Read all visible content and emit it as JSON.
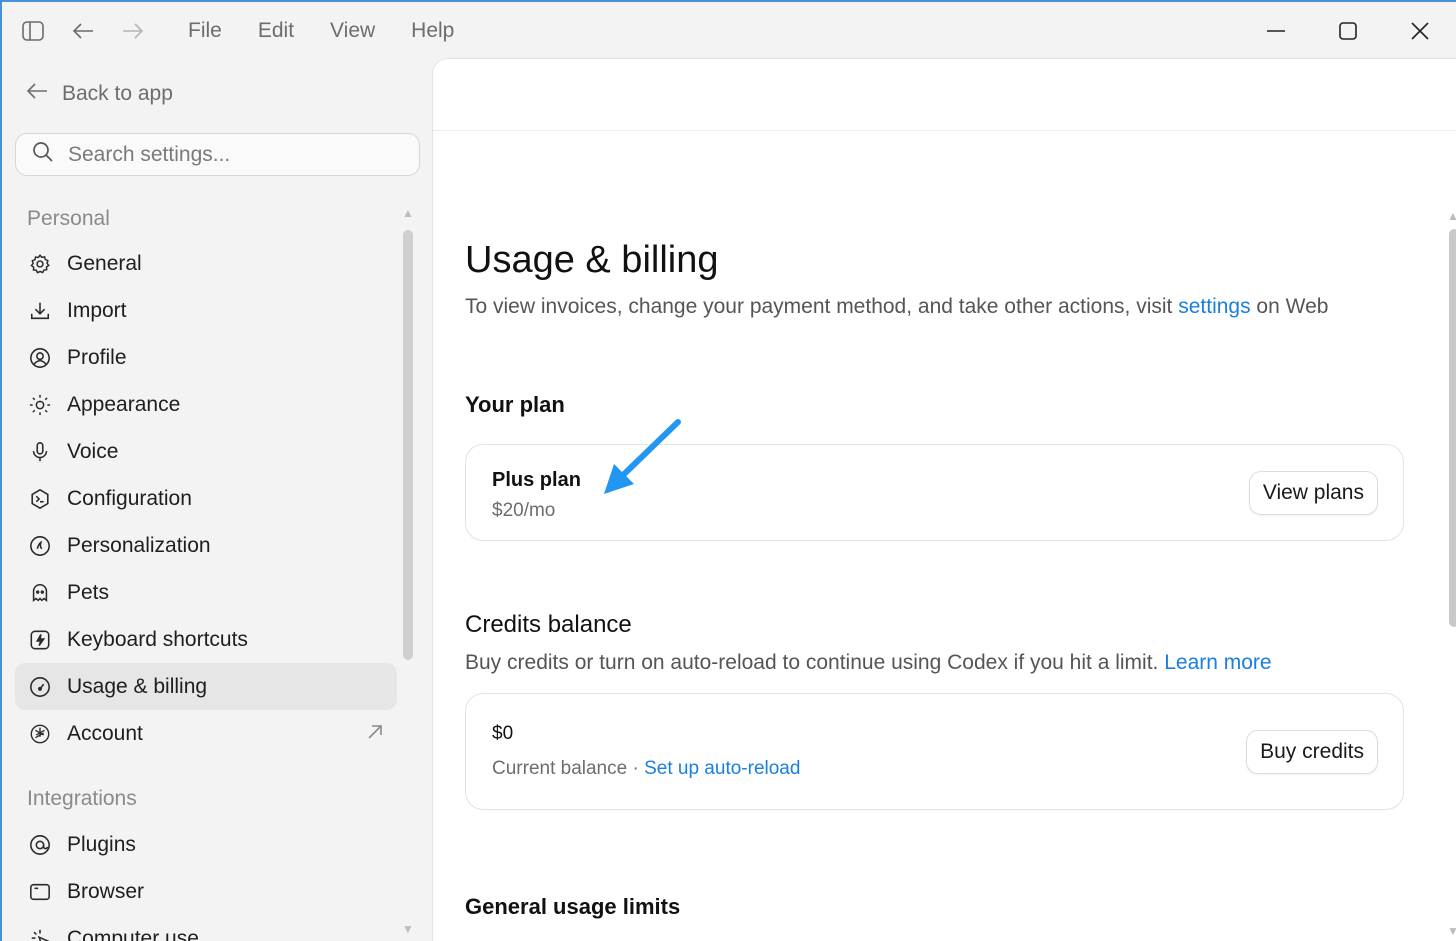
{
  "titlebar": {
    "menu": [
      "File",
      "Edit",
      "View",
      "Help"
    ]
  },
  "sidebar": {
    "back_label": "Back to app",
    "search_placeholder": "Search settings...",
    "personal_label": "Personal",
    "personal_items": [
      {
        "label": "General",
        "icon": "gear-icon"
      },
      {
        "label": "Import",
        "icon": "download-icon"
      },
      {
        "label": "Profile",
        "icon": "user-circle-icon"
      },
      {
        "label": "Appearance",
        "icon": "sun-icon"
      },
      {
        "label": "Voice",
        "icon": "microphone-icon"
      },
      {
        "label": "Configuration",
        "icon": "terminal-icon"
      },
      {
        "label": "Personalization",
        "icon": "sparkle-icon"
      },
      {
        "label": "Pets",
        "icon": "pet-icon"
      },
      {
        "label": "Keyboard shortcuts",
        "icon": "lightning-icon"
      },
      {
        "label": "Usage & billing",
        "icon": "gauge-icon",
        "active": true
      },
      {
        "label": "Account",
        "icon": "openai-icon",
        "external": true
      }
    ],
    "integrations_label": "Integrations",
    "integration_items": [
      {
        "label": "Plugins",
        "icon": "plugin-icon"
      },
      {
        "label": "Browser",
        "icon": "browser-icon"
      },
      {
        "label": "Computer use",
        "icon": "cursor-icon"
      }
    ]
  },
  "main": {
    "title": "Usage & billing",
    "subtitle_before": "To view invoices, change your payment method, and take other actions, visit ",
    "subtitle_link": "settings",
    "subtitle_after": " on Web",
    "plan_heading": "Your plan",
    "plan_name": "Plus plan",
    "plan_price": "$20/mo",
    "view_plans_label": "View plans",
    "credits_heading": "Credits balance",
    "credits_desc_before": "Buy credits or turn on auto-reload to continue using Codex if you hit a limit. ",
    "credits_desc_link": "Learn more",
    "balance_value": "$0",
    "balance_label": "Current balance",
    "balance_separator": "·",
    "auto_reload_link": "Set up auto-reload",
    "buy_credits_label": "Buy credits",
    "usage_heading": "General usage limits"
  },
  "colors": {
    "accent_link": "#1a7fe0",
    "annotation_arrow": "#2196f3",
    "active_nav_bg": "#e6e6e6"
  }
}
